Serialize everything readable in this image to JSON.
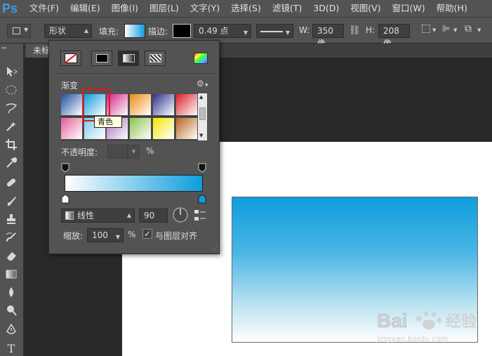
{
  "app": {
    "logo": "Ps"
  },
  "menu": [
    "文件(F)",
    "编辑(E)",
    "图像(I)",
    "图层(L)",
    "文字(Y)",
    "选择(S)",
    "滤镜(T)",
    "3D(D)",
    "视图(V)",
    "窗口(W)",
    "帮助(H)"
  ],
  "options": {
    "mode": "形状",
    "fill_label": "填充:",
    "stroke_label": "描边:",
    "stroke_width": "0.49 点",
    "w_label": "W:",
    "w_value": "350 像",
    "h_label": "H:",
    "h_value": "208 像"
  },
  "document": {
    "tab_title": "未标"
  },
  "gradient_panel": {
    "section_title": "渐变",
    "tooltip": "青色",
    "opacity_label": "不透明度:",
    "opacity_value": "",
    "percent": "%",
    "style": "线性",
    "angle": "90",
    "scale_label": "缩放:",
    "scale_value": "100",
    "scale_percent": "%",
    "align_label": "与图层对齐",
    "align_checked": true
  },
  "presets": [
    [
      "#1a4fa0",
      "#ffffff"
    ],
    [
      "#0f9ddd",
      "#ffffff"
    ],
    [
      "#d21f7f",
      "#ffffff"
    ],
    [
      "#ee8a12",
      "#ffffff"
    ],
    [
      "#2a2f8c",
      "#ffffff"
    ],
    [
      "#d81f26",
      "#ffffff"
    ],
    [
      "#e45c98",
      "#ffffff"
    ],
    [
      "#7bc6ea",
      "#ffffff"
    ],
    [
      "#a46cb6",
      "#ffffff"
    ],
    [
      "#8bc34a",
      "#ffffff"
    ],
    [
      "#f4e700",
      "#ffffff"
    ],
    [
      "#b5651d",
      "#ffffff"
    ]
  ],
  "colors": {
    "gradient_start": "#ffffff",
    "gradient_end": "#0e9ddd",
    "highlight": "#e0191d",
    "ps_blue": "#3c9de9"
  },
  "watermark": {
    "brand": "Bai",
    "brand2": "经验",
    "url": "jingyan.baidu.com"
  }
}
